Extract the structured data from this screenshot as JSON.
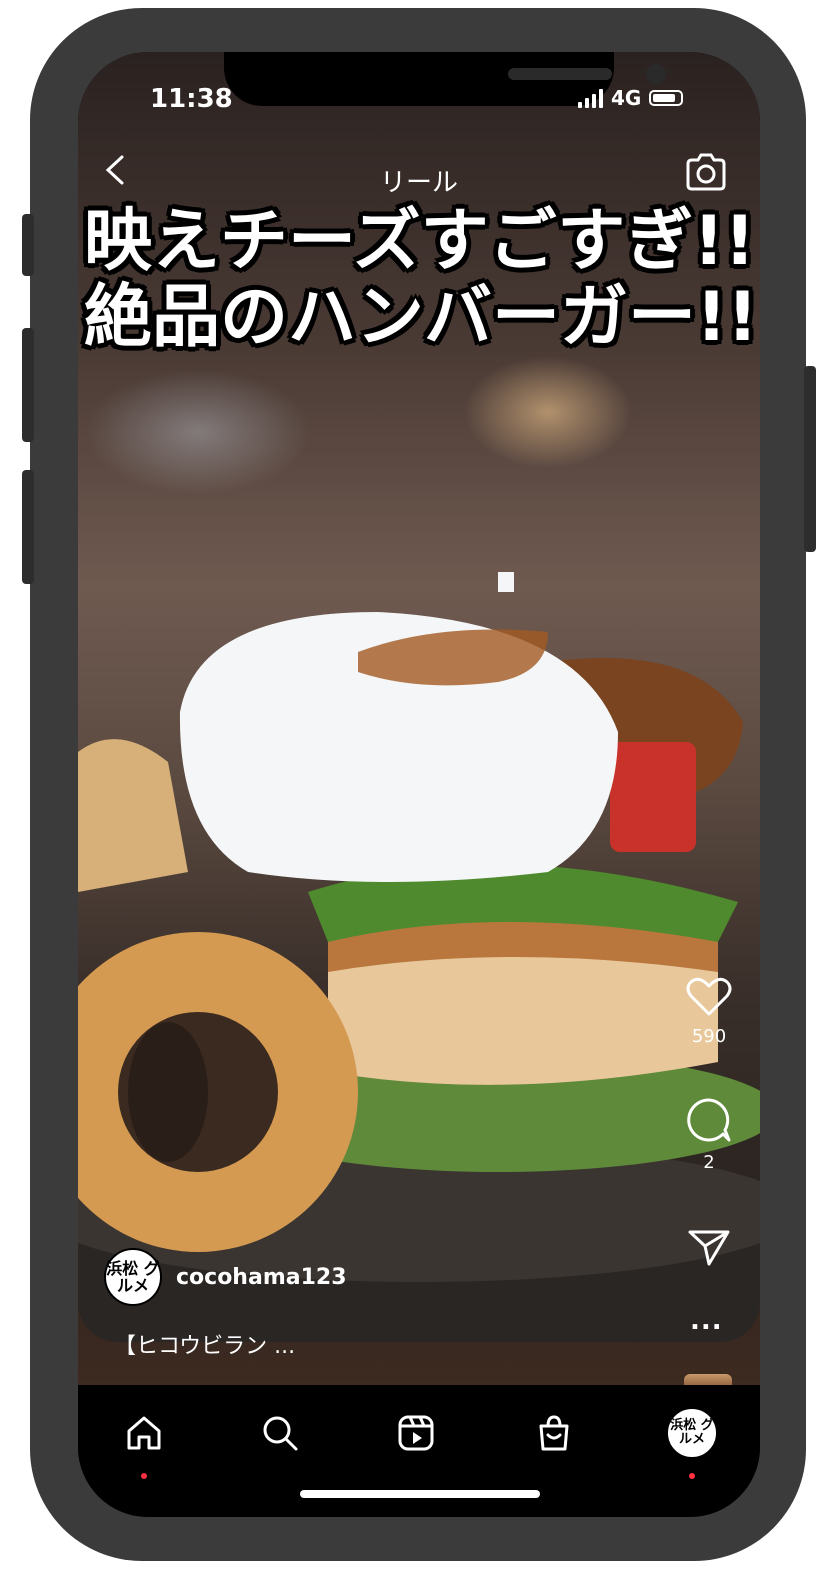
{
  "status_bar": {
    "time": "11:38",
    "network": "4G"
  },
  "header": {
    "title": "リール",
    "back_icon": "chevron-left-icon",
    "camera_icon": "camera-icon"
  },
  "overlay_text": {
    "line1": "映えチーズすごすぎ!!",
    "line2": "絶品のハンバーガー!!"
  },
  "actions": {
    "likes": "590",
    "comments": "2"
  },
  "post": {
    "avatar_text": "浜松 グルメ",
    "username": "cocohama123",
    "caption": "【ヒコウビラン ...",
    "more_label": "..."
  },
  "nav": {
    "items": [
      "home-icon",
      "search-icon",
      "reels-icon",
      "shop-icon",
      "profile-avatar"
    ],
    "profile_avatar_text": "浜松 グルメ"
  },
  "colors": {
    "background": "#000000",
    "text": "#ffffff",
    "notification_dot": "#ff3040"
  }
}
